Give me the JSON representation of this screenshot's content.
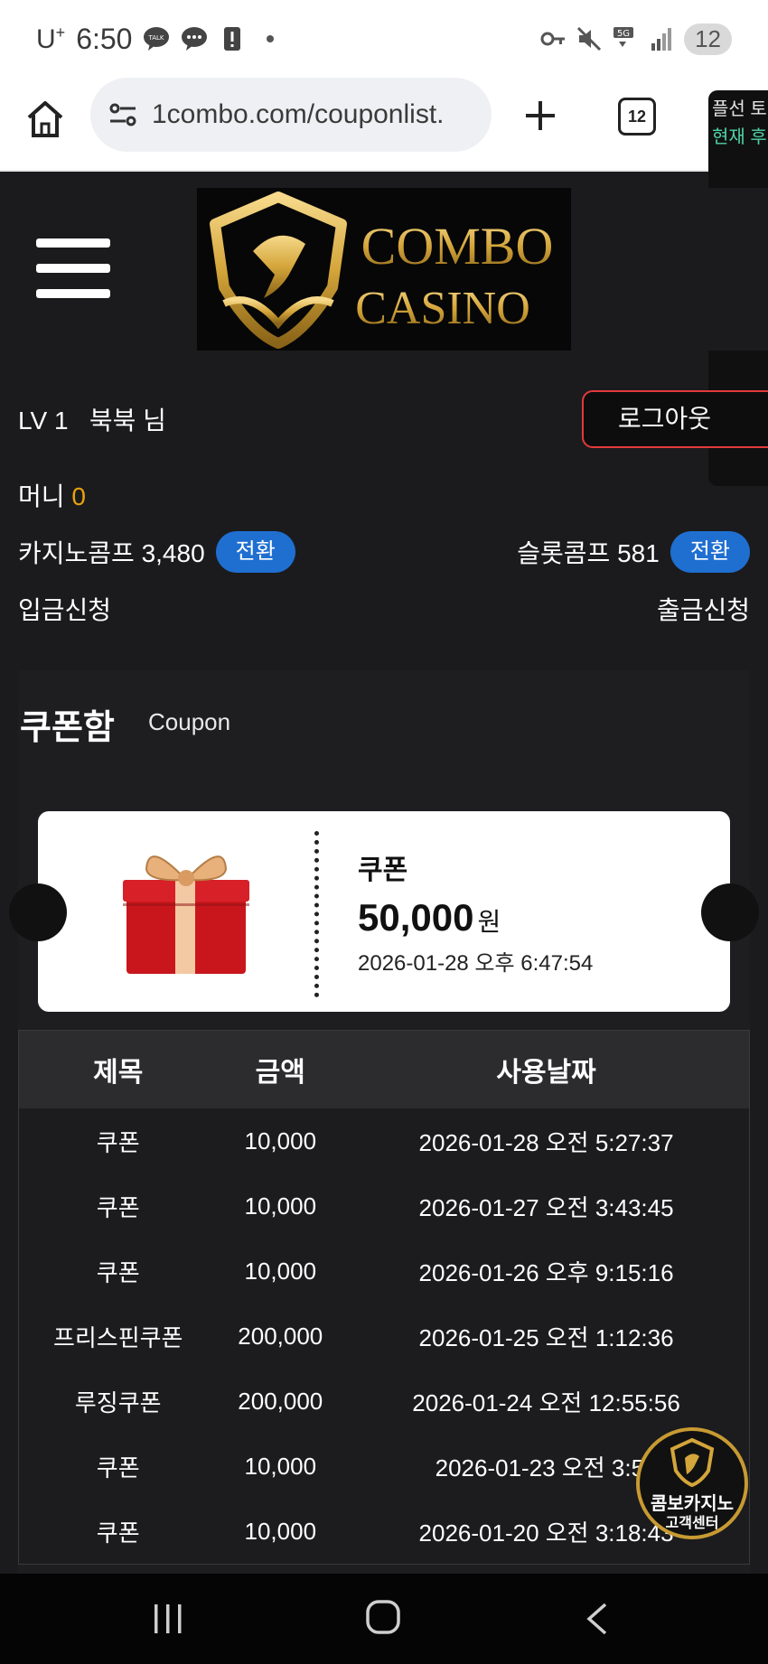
{
  "status_bar": {
    "carrier": "U",
    "carrier_sup": "+",
    "time": "6:50",
    "talk_icon_label": "TALK",
    "tab_count": "12"
  },
  "browser": {
    "url": "1combo.com/couponlist.",
    "tabs_count": "12"
  },
  "side_overlay": {
    "line1": "플선 토",
    "line2": "현재 후"
  },
  "header": {
    "logo_line1": "COMBO",
    "logo_line2": "CASINO"
  },
  "user": {
    "level": "LV 1",
    "name": "북북 님",
    "logout_label": "로그아웃",
    "money_label": "머니",
    "money_value": "0",
    "casino_comp_label": "카지노콤프 3,480",
    "slot_comp_label": "슬롯콤프 581",
    "convert_label": "전환",
    "deposit_label": "입금신청",
    "withdraw_label": "출금신청"
  },
  "coupon_section": {
    "title": "쿠폰함",
    "subtitle": "Coupon",
    "card": {
      "name": "쿠폰",
      "amount": "50,000",
      "unit": "원",
      "date": "2026-01-28 오후 6:47:54"
    },
    "columns": [
      "제목",
      "금액",
      "사용날짜"
    ],
    "rows": [
      {
        "title": "쿠폰",
        "amount": "10,000",
        "date": "2026-01-28 오전 5:27:37"
      },
      {
        "title": "쿠폰",
        "amount": "10,000",
        "date": "2026-01-27 오전 3:43:45"
      },
      {
        "title": "쿠폰",
        "amount": "10,000",
        "date": "2026-01-26 오후 9:15:16"
      },
      {
        "title": "프리스핀쿠폰",
        "amount": "200,000",
        "date": "2026-01-25 오전 1:12:36"
      },
      {
        "title": "루징쿠폰",
        "amount": "200,000",
        "date": "2026-01-24 오전 12:55:56"
      },
      {
        "title": "쿠폰",
        "amount": "10,000",
        "date": "2026-01-23 오전 3:50"
      },
      {
        "title": "쿠폰",
        "amount": "10,000",
        "date": "2026-01-20 오전 3:18:43"
      }
    ]
  },
  "support_badge": {
    "line1": "콤보카지노",
    "line2": "고객센터"
  },
  "colors": {
    "accent_money": "#e8a20c",
    "convert_button": "#1f6fd1",
    "logout_border": "#e33a3a",
    "logo_gold": "#d4a53a"
  }
}
